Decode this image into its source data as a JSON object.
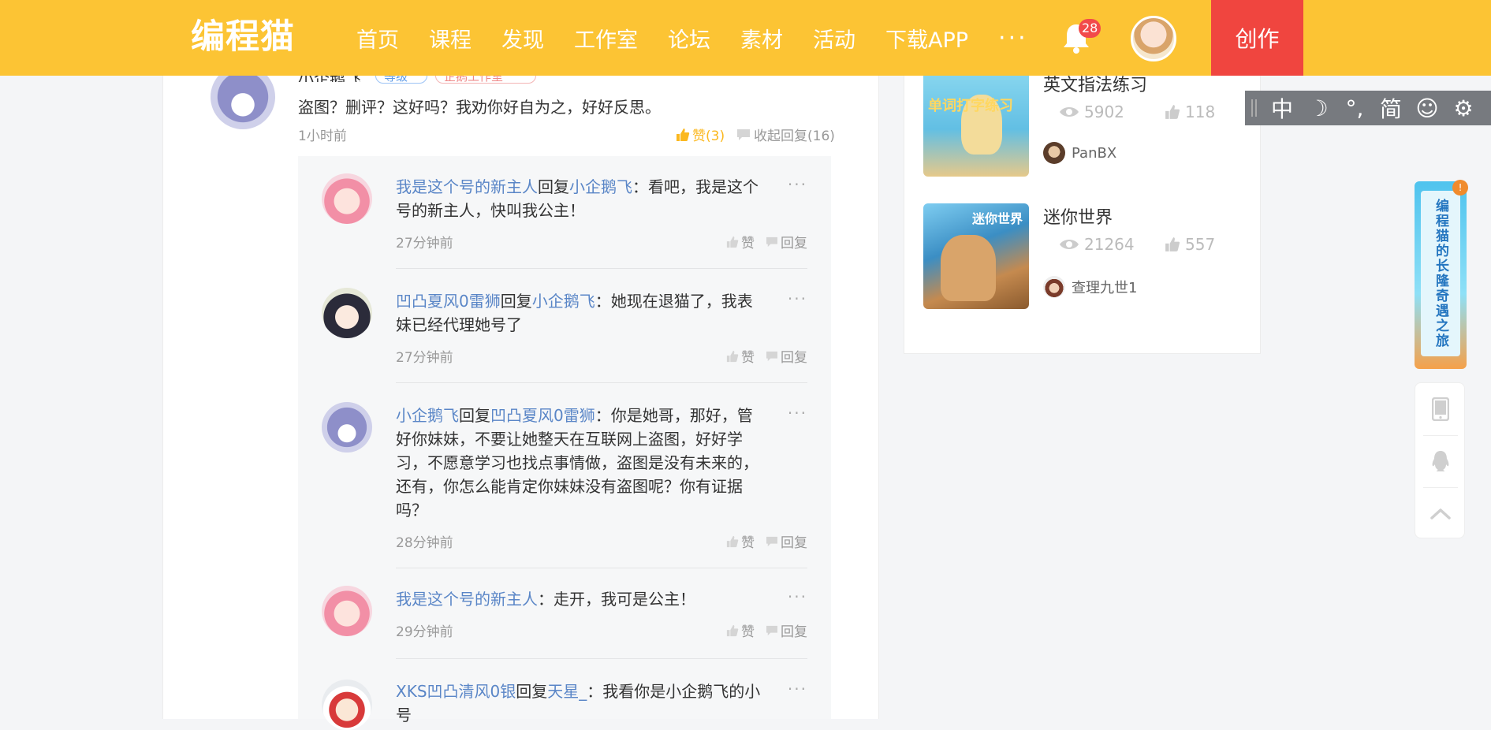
{
  "header": {
    "logo": "编程猫",
    "nav": [
      "首页",
      "课程",
      "发现",
      "工作室",
      "论坛",
      "素材",
      "活动",
      "下载APP"
    ],
    "more": "···",
    "notification_count": "28",
    "create_label": "创作"
  },
  "top_comment": {
    "name": "小企鹅飞",
    "tag1": "等级",
    "tag2": "企鹅工作室",
    "text": "盗图？删评？这好吗？我劝你好自为之，好好反思。",
    "time": "1小时前",
    "like_label": "赞(3)",
    "collapse_label": "收起回复(16)"
  },
  "replies": [
    {
      "user": "我是这个号的新主人",
      "verb": "回复",
      "target": "小企鹅飞",
      "text": "：看吧，我是这个号的新主人，快叫我公主！",
      "time": "27分钟前",
      "like": "赞",
      "reply": "回复",
      "more": "···"
    },
    {
      "user": "凹凸夏风0雷狮",
      "verb": "回复",
      "target": "小企鹅飞",
      "text": "：她现在退猫了，我表妹已经代理她号了",
      "time": "27分钟前",
      "like": "赞",
      "reply": "回复",
      "more": "···"
    },
    {
      "user": "小企鹅飞",
      "verb": "回复",
      "target": "凹凸夏风0雷狮",
      "text": "：你是她哥，那好，管好你妹妹，不要让她整天在互联网上盗图，好好学习，不愿意学习也找点事情做，盗图是没有未来的，还有，你怎么能肯定你妹妹没有盗图呢？你有证据吗？",
      "time": "28分钟前",
      "like": "赞",
      "reply": "回复",
      "more": "···"
    },
    {
      "user": "我是这个号的新主人",
      "verb": "",
      "target": "",
      "text": "：走开，我可是公主！",
      "time": "29分钟前",
      "like": "赞",
      "reply": "回复",
      "more": "···"
    },
    {
      "user": "XKS凹凸清风0银",
      "verb": "回复",
      "target": "天星_",
      "text": "：我看你是小企鹅飞的小号",
      "time": "",
      "like": "",
      "reply": "",
      "more": "···"
    }
  ],
  "side_works": [
    {
      "title": "英文指法练习",
      "thumb_label": "单词打字练习",
      "views": "5902",
      "likes": "118",
      "author": "PanBX"
    },
    {
      "title": "迷你世界",
      "thumb_label": "迷你世界",
      "views": "21264",
      "likes": "557",
      "author": "查理九世1"
    }
  ],
  "reading_toolbar": [
    "中",
    "☽",
    "°,",
    "简",
    "☺",
    "⚙"
  ],
  "promo": {
    "text": "编程猫的长隆奇遇之旅",
    "badge": "!"
  },
  "float_bar": {
    "phone_icon": "phone-icon",
    "qq_icon": "qq-icon",
    "top_icon": "back-to-top-icon"
  },
  "colors": {
    "brand": "#fcc434",
    "create": "#f0453f",
    "link": "#5a86c7",
    "like_active": "#fbb81f"
  }
}
